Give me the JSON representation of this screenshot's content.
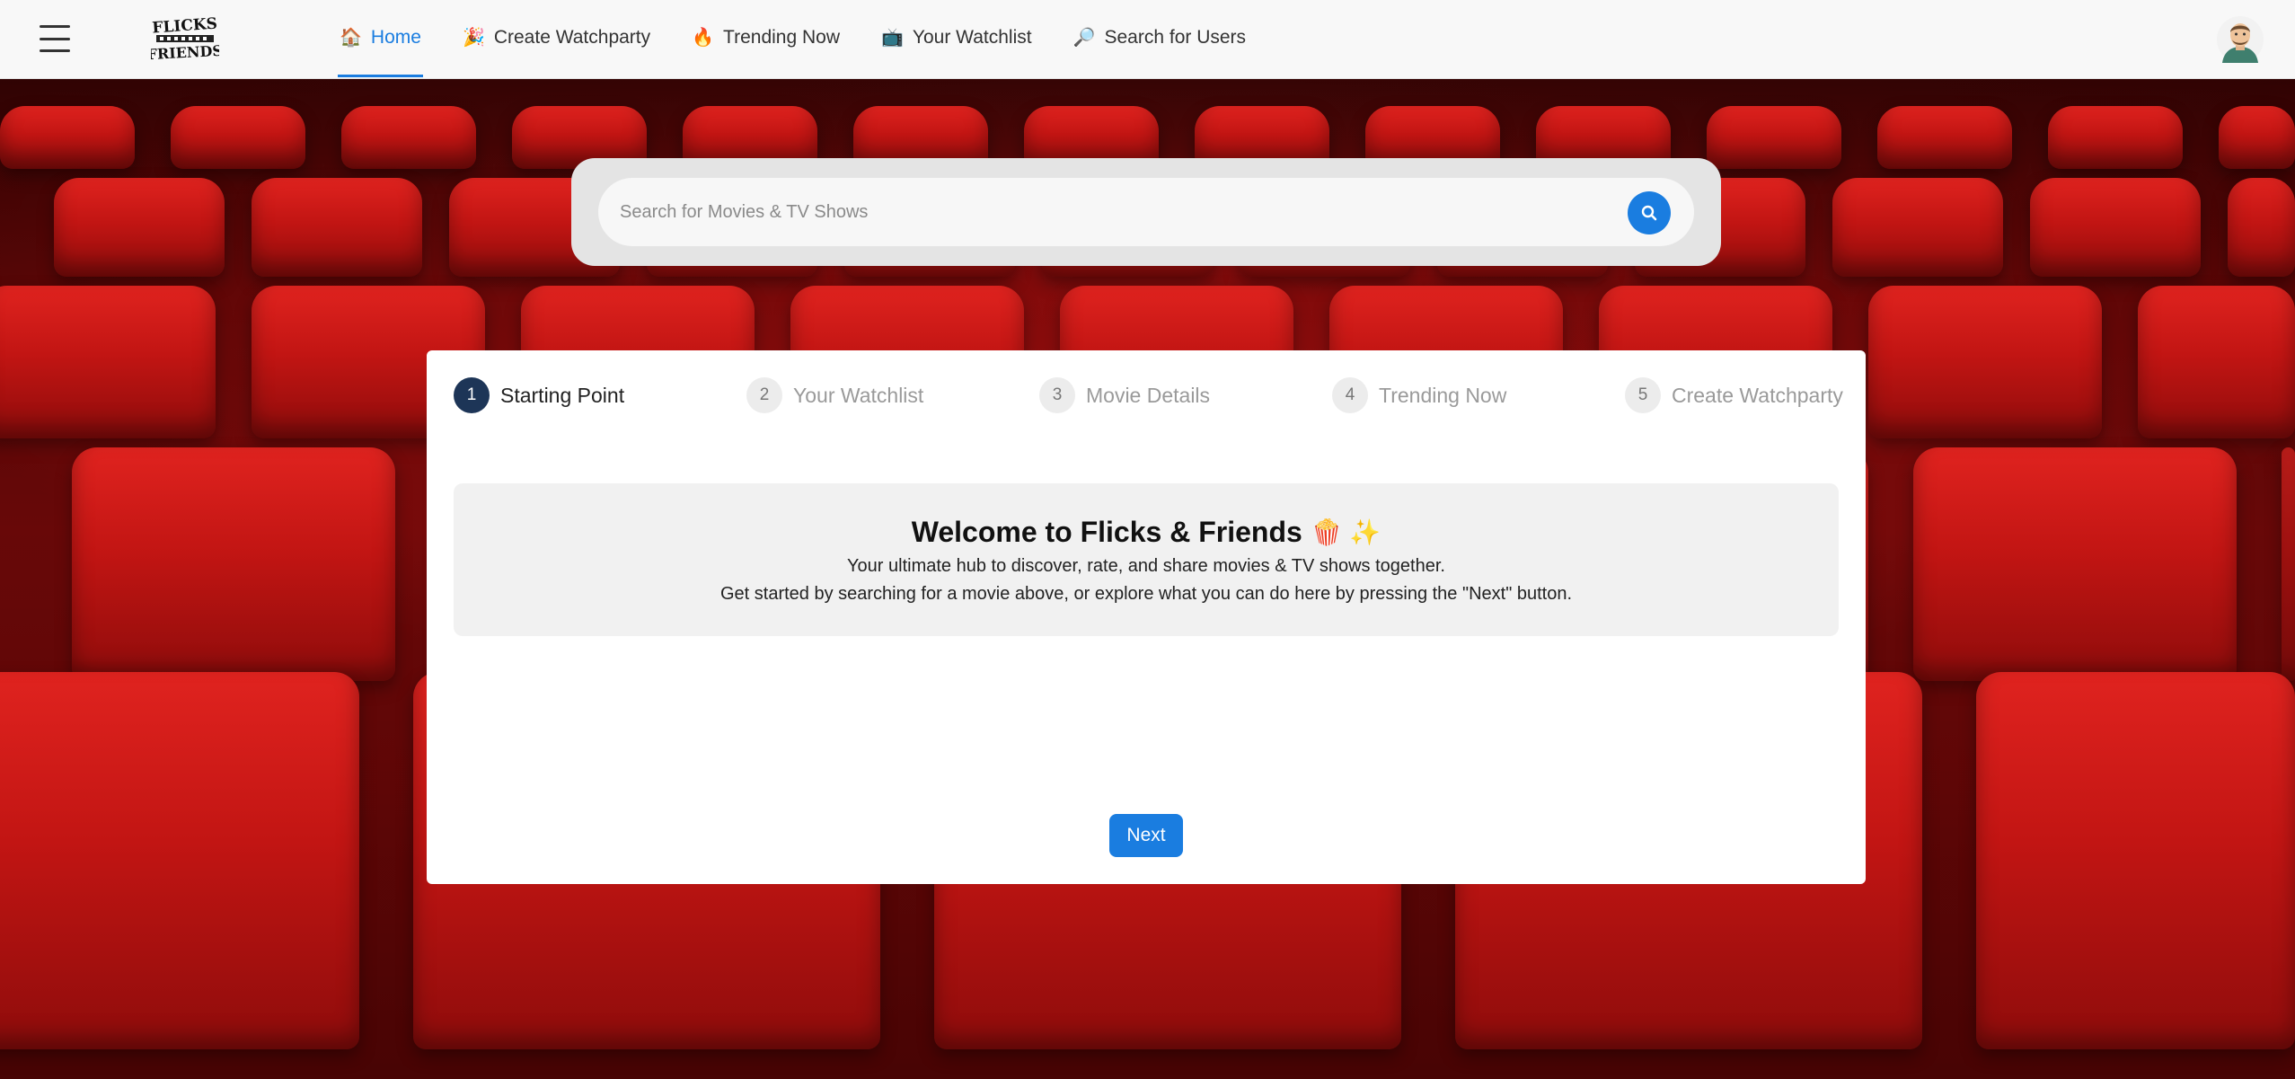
{
  "nav": {
    "items": [
      {
        "icon": "🏠",
        "label": "Home",
        "active": true
      },
      {
        "icon": "🎉",
        "label": "Create Watchparty",
        "active": false
      },
      {
        "icon": "🔥",
        "label": "Trending Now",
        "active": false
      },
      {
        "icon": "📺",
        "label": "Your Watchlist",
        "active": false
      },
      {
        "icon": "🔎",
        "label": "Search for Users",
        "active": false
      }
    ]
  },
  "logo": {
    "line1": "FLICKS",
    "line2": "FRIENDS"
  },
  "search": {
    "placeholder": "Search for Movies & TV Shows",
    "value": ""
  },
  "steps": [
    {
      "number": "1",
      "label": "Starting Point",
      "active": true
    },
    {
      "number": "2",
      "label": "Your Watchlist",
      "active": false
    },
    {
      "number": "3",
      "label": "Movie Details",
      "active": false
    },
    {
      "number": "4",
      "label": "Trending Now",
      "active": false
    },
    {
      "number": "5",
      "label": "Create Watchparty",
      "active": false
    }
  ],
  "welcome": {
    "title": "Welcome to Flicks & Friends",
    "emoji": "🍿 ✨",
    "line1": "Your ultimate hub to discover, rate, and share movies & TV shows together.",
    "line2": "Get started by searching for a movie above, or explore what you can do here by pressing the \"Next\" button."
  },
  "next_label": "Next",
  "colors": {
    "accent": "#1a7de0",
    "active_step": "#1d3557",
    "seat_red": "#c21513",
    "topbar_bg": "#f8f8f8"
  }
}
